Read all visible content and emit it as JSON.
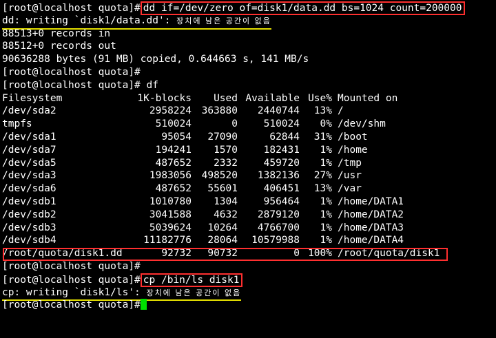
{
  "terminal": {
    "prompt": "[root@localhost quota]#",
    "cmd1": "dd if=/dev/zero of=disk1/data.dd bs=1024 count=200000",
    "dd_error_prefix": "dd: writing `disk1/data.dd': ",
    "dd_error_msg": "장치에 남은 공간이 없음",
    "records_in": "88513+0 records in",
    "records_out": "88512+0 records out",
    "copied": "90636288 bytes (91 MB) copied, 0.644663 s, 141 MB/s",
    "cmd_df": "df",
    "cmd3": "cp /bin/ls disk1",
    "cp_error_prefix": "cp: writing `disk1/ls': ",
    "cp_error_msg": "장치에 남은 공간이 없음"
  },
  "df": {
    "headers": [
      "Filesystem",
      "1K-blocks",
      "Used",
      "Available",
      "Use%",
      "Mounted on"
    ],
    "rows": [
      [
        "/dev/sda2",
        "2958224",
        "363880",
        "2440744",
        "13%",
        "/"
      ],
      [
        "tmpfs",
        "510024",
        "0",
        "510024",
        "0%",
        "/dev/shm"
      ],
      [
        "/dev/sda1",
        "95054",
        "27090",
        "62844",
        "31%",
        "/boot"
      ],
      [
        "/dev/sda7",
        "194241",
        "1570",
        "182431",
        "1%",
        "/home"
      ],
      [
        "/dev/sda5",
        "487652",
        "2332",
        "459720",
        "1%",
        "/tmp"
      ],
      [
        "/dev/sda3",
        "1983056",
        "498520",
        "1382136",
        "27%",
        "/usr"
      ],
      [
        "/dev/sda6",
        "487652",
        "55601",
        "406451",
        "13%",
        "/var"
      ],
      [
        "/dev/sdb1",
        "1010780",
        "1304",
        "956464",
        "1%",
        "/home/DATA1"
      ],
      [
        "/dev/sdb2",
        "3041588",
        "4632",
        "2879120",
        "1%",
        "/home/DATA2"
      ],
      [
        "/dev/sdb3",
        "5039624",
        "10264",
        "4766700",
        "1%",
        "/home/DATA3"
      ],
      [
        "/dev/sdb4",
        "11182776",
        "28064",
        "10579988",
        "1%",
        "/home/DATA4"
      ],
      [
        "/root/quota/disk1.dd",
        "92732",
        "90732",
        "0",
        "100%",
        "/root/quota/disk1"
      ]
    ]
  },
  "colors": {
    "background": "#000000",
    "text": "#ffffff",
    "highlight_box": "#ff2f2f",
    "warning_underline": "#e5e000",
    "cursor": "#00e000"
  }
}
